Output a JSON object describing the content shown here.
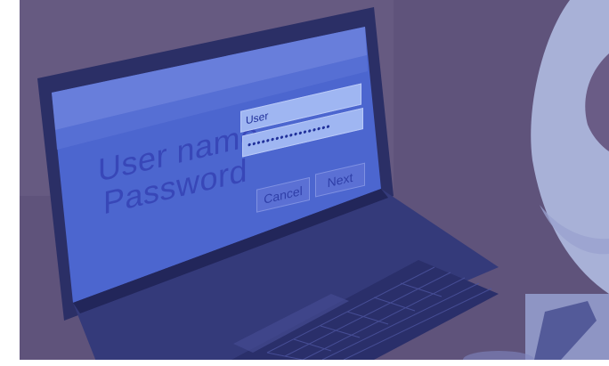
{
  "login_screen": {
    "username_label": "User name",
    "password_label": "Password",
    "username_value": "User",
    "password_value": "••••••••••••••••••",
    "cancel_label": "Cancel",
    "next_label": "Next"
  },
  "colors": {
    "background_overlay": "#5e527a",
    "screen_blue": "#4f68d2",
    "laptop_body": "#2a2f63",
    "accent_light": "#a9b2d8"
  }
}
